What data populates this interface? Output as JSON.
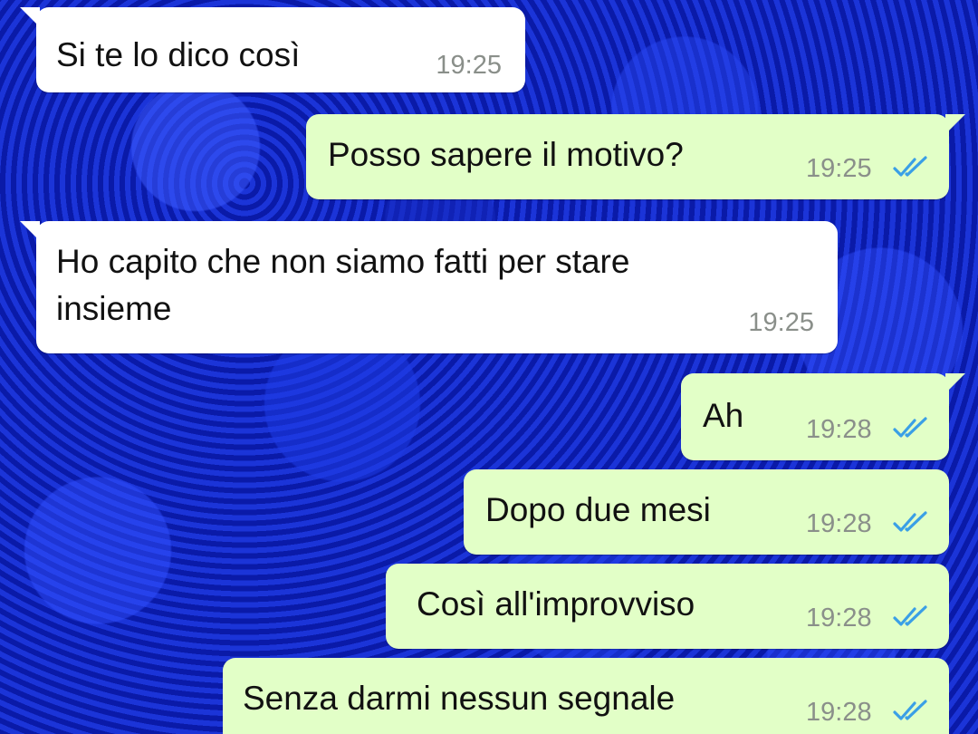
{
  "colors": {
    "incoming_bubble": "#ffffff",
    "outgoing_bubble": "#e2ffc7",
    "read_ticks": "#3a9fe6",
    "wallpaper": "#0b1fb0"
  },
  "wallpaper": {
    "description_icon": "blue-roses-wallpaper"
  },
  "messages": [
    {
      "direction": "in",
      "text": "Si te lo dico così",
      "time": "19:25"
    },
    {
      "direction": "out",
      "text": "Posso sapere il motivo?",
      "time": "19:25",
      "status": "read"
    },
    {
      "direction": "in",
      "text_line1": "Ho capito che non siamo fatti per stare",
      "text_line2": "insieme",
      "time": "19:25"
    },
    {
      "direction": "out",
      "text": "Ah",
      "time": "19:28",
      "status": "read"
    },
    {
      "direction": "out",
      "text": "Dopo due mesi",
      "time": "19:28",
      "status": "read"
    },
    {
      "direction": "out",
      "text": "Così all'improvviso",
      "time": "19:28",
      "status": "read"
    },
    {
      "direction": "out",
      "text": "Senza darmi nessun segnale",
      "time": "19:28",
      "status": "read"
    }
  ]
}
